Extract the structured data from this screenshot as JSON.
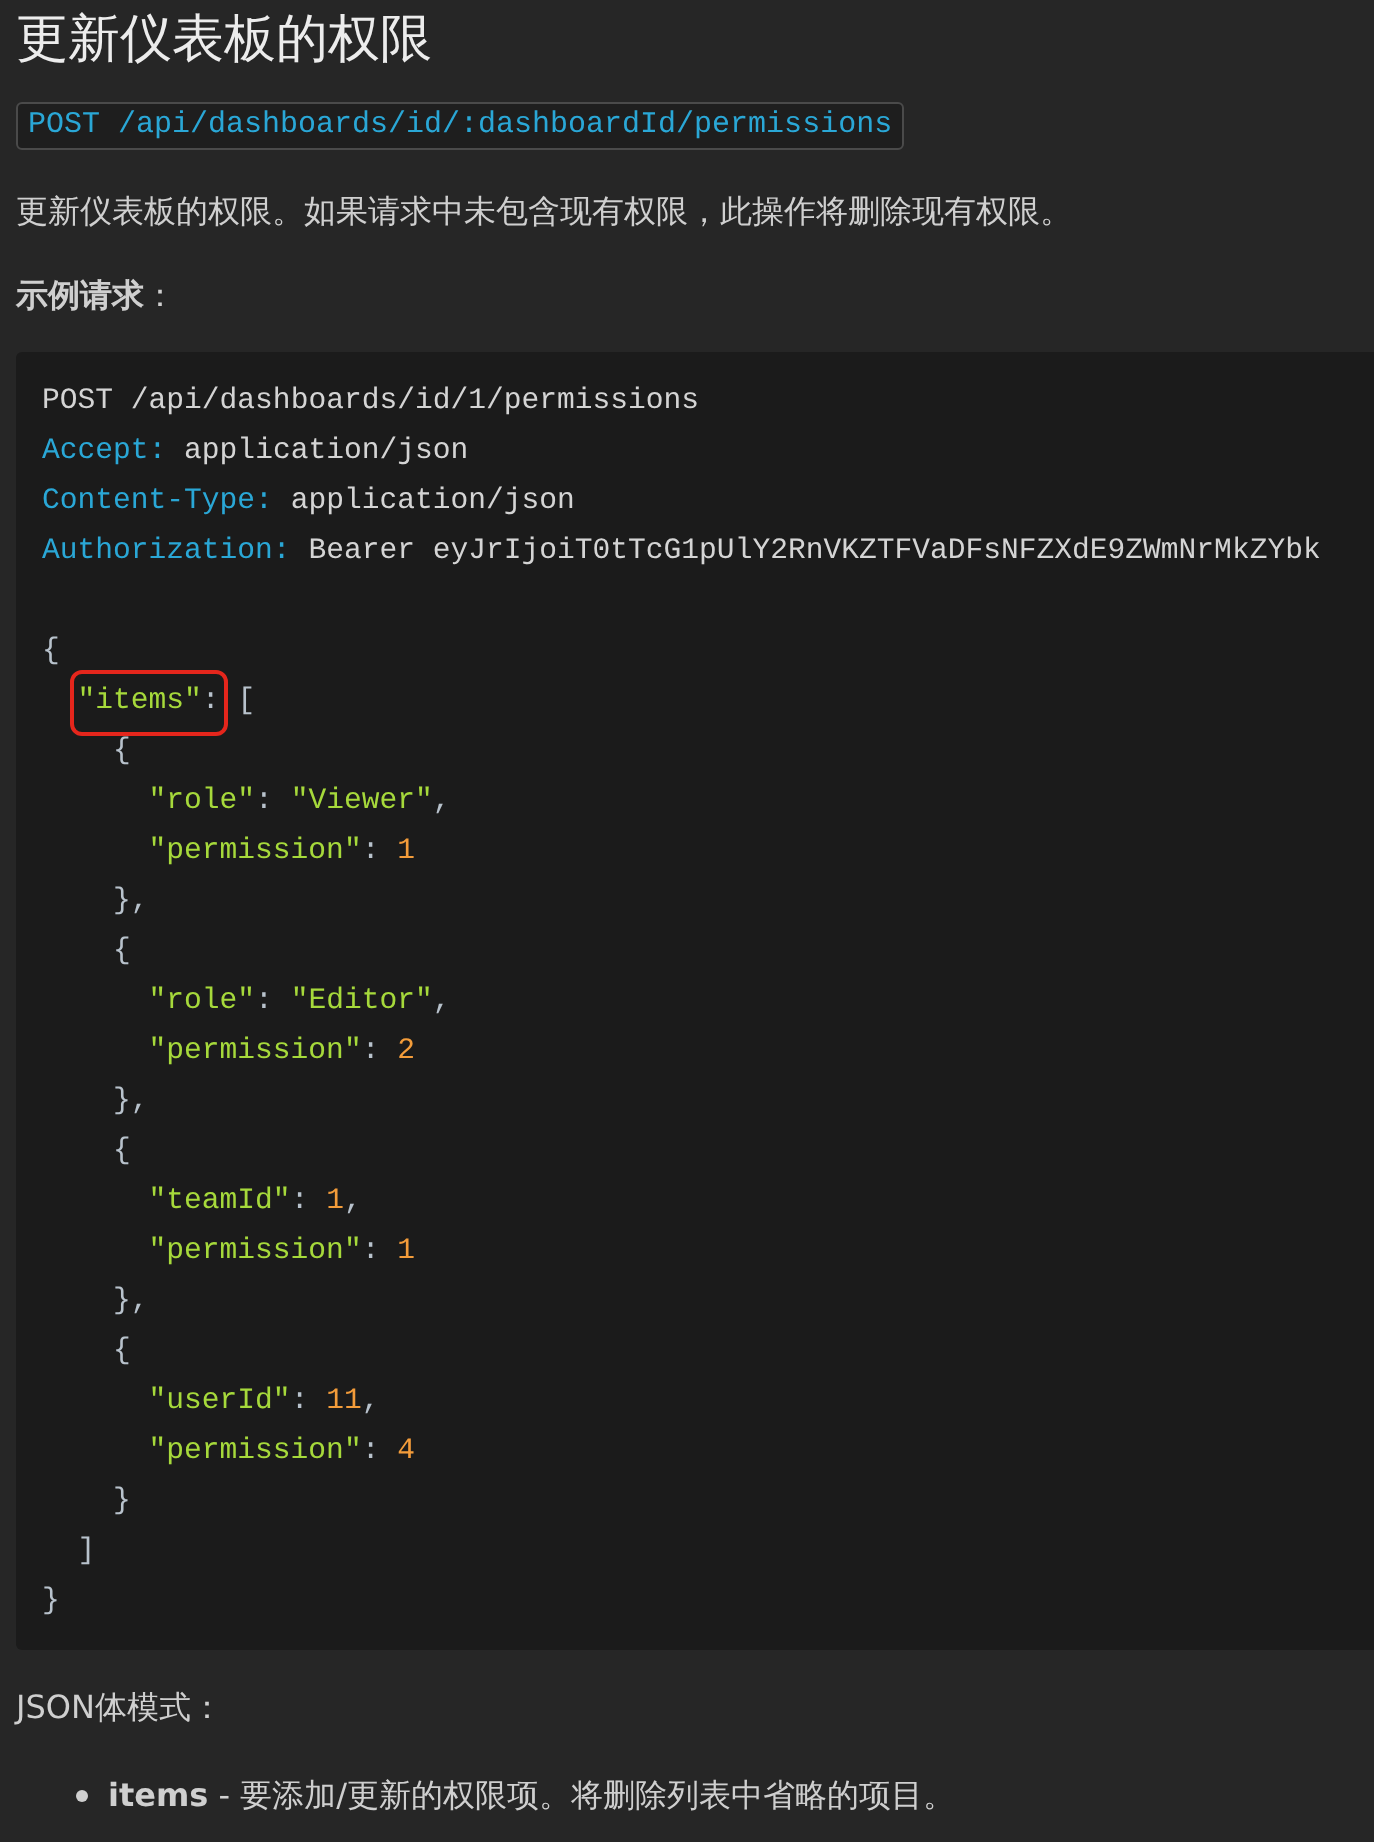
{
  "title": "更新仪表板的权限",
  "endpoint": "POST /api/dashboards/id/:dashboardId/permissions",
  "description": "更新仪表板的权限。如果请求中未包含现有权限，此操作将删除现有权限。",
  "example_label": "示例请求",
  "example_colon": "：",
  "code_lines": [
    {
      "kind": "flat",
      "tokens": [
        {
          "kind": "plain",
          "text": "POST /api/dashboards/id/1/permissions"
        }
      ]
    },
    {
      "kind": "flat",
      "tokens": [
        {
          "kind": "header",
          "text": "Accept:"
        },
        {
          "kind": "plain",
          "text": "application/json"
        }
      ]
    },
    {
      "kind": "flat",
      "tokens": [
        {
          "kind": "header",
          "text": "Content-Type:"
        },
        {
          "kind": "plain",
          "text": "application/json"
        }
      ]
    },
    {
      "kind": "flat",
      "tokens": [
        {
          "kind": "header",
          "text": "Authorization:"
        },
        {
          "kind": "plain",
          "text": "Bearer eyJrIjoiT0tTcG1pUlY2RnVKZTFVaDFsNFZXdE9ZWmNrMkZYbk"
        }
      ]
    },
    {
      "kind": "blank"
    },
    {
      "kind": "flat",
      "tokens": [
        {
          "kind": "punct",
          "text": "{"
        }
      ]
    },
    {
      "kind": "inner",
      "tokens": [
        {
          "kind": "mark",
          "tokens": [
            {
              "kind": "key",
              "text": "\"items\""
            },
            {
              "kind": "punct",
              "text": ":"
            }
          ]
        },
        {
          "kind": "punct",
          "text": "["
        }
      ]
    },
    {
      "kind": "deeper",
      "tokens": [
        {
          "kind": "punct",
          "text": "{"
        }
      ]
    },
    {
      "kind": "deepest",
      "tokens": [
        {
          "kind": "key",
          "text": "\"role\""
        },
        {
          "kind": "punct",
          "text": ":"
        },
        {
          "kind": "string",
          "text": "\"Viewer\""
        },
        {
          "kind": "punct",
          "text": ","
        }
      ]
    },
    {
      "kind": "deepest",
      "tokens": [
        {
          "kind": "key",
          "text": "\"permission\""
        },
        {
          "kind": "punct",
          "text": ":"
        },
        {
          "kind": "number",
          "text": "1"
        }
      ]
    },
    {
      "kind": "deeper",
      "tokens": [
        {
          "kind": "punct",
          "text": "},"
        }
      ]
    },
    {
      "kind": "deeper",
      "tokens": [
        {
          "kind": "punct",
          "text": "{"
        }
      ]
    },
    {
      "kind": "deepest",
      "tokens": [
        {
          "kind": "key",
          "text": "\"role\""
        },
        {
          "kind": "punct",
          "text": ":"
        },
        {
          "kind": "string",
          "text": "\"Editor\""
        },
        {
          "kind": "punct",
          "text": ","
        }
      ]
    },
    {
      "kind": "deepest",
      "tokens": [
        {
          "kind": "key",
          "text": "\"permission\""
        },
        {
          "kind": "punct",
          "text": ":"
        },
        {
          "kind": "number",
          "text": "2"
        }
      ]
    },
    {
      "kind": "deeper",
      "tokens": [
        {
          "kind": "punct",
          "text": "},"
        }
      ]
    },
    {
      "kind": "deeper",
      "tokens": [
        {
          "kind": "punct",
          "text": "{"
        }
      ]
    },
    {
      "kind": "deepest",
      "tokens": [
        {
          "kind": "key",
          "text": "\"teamId\""
        },
        {
          "kind": "punct",
          "text": ":"
        },
        {
          "kind": "number",
          "text": "1"
        },
        {
          "kind": "punct",
          "text": ","
        }
      ]
    },
    {
      "kind": "deepest",
      "tokens": [
        {
          "kind": "key",
          "text": "\"permission\""
        },
        {
          "kind": "punct",
          "text": ":"
        },
        {
          "kind": "number",
          "text": "1"
        }
      ]
    },
    {
      "kind": "deeper",
      "tokens": [
        {
          "kind": "punct",
          "text": "},"
        }
      ]
    },
    {
      "kind": "deeper",
      "tokens": [
        {
          "kind": "punct",
          "text": "{"
        }
      ]
    },
    {
      "kind": "deepest",
      "tokens": [
        {
          "kind": "key",
          "text": "\"userId\""
        },
        {
          "kind": "punct",
          "text": ":"
        },
        {
          "kind": "number",
          "text": "11"
        },
        {
          "kind": "punct",
          "text": ","
        }
      ]
    },
    {
      "kind": "deepest",
      "tokens": [
        {
          "kind": "key",
          "text": "\"permission\""
        },
        {
          "kind": "punct",
          "text": ":"
        },
        {
          "kind": "number",
          "text": "4"
        }
      ]
    },
    {
      "kind": "deeper",
      "tokens": [
        {
          "kind": "punct",
          "text": "}"
        }
      ]
    },
    {
      "kind": "inner",
      "tokens": [
        {
          "kind": "punct",
          "text": "]"
        }
      ]
    },
    {
      "kind": "flat",
      "tokens": [
        {
          "kind": "punct",
          "text": "}"
        }
      ]
    }
  ],
  "schema_label": "JSON体模式：",
  "schema_items": [
    "**items** - 要添加/更新的权限项。将删除列表中省略的项目。"
  ]
}
